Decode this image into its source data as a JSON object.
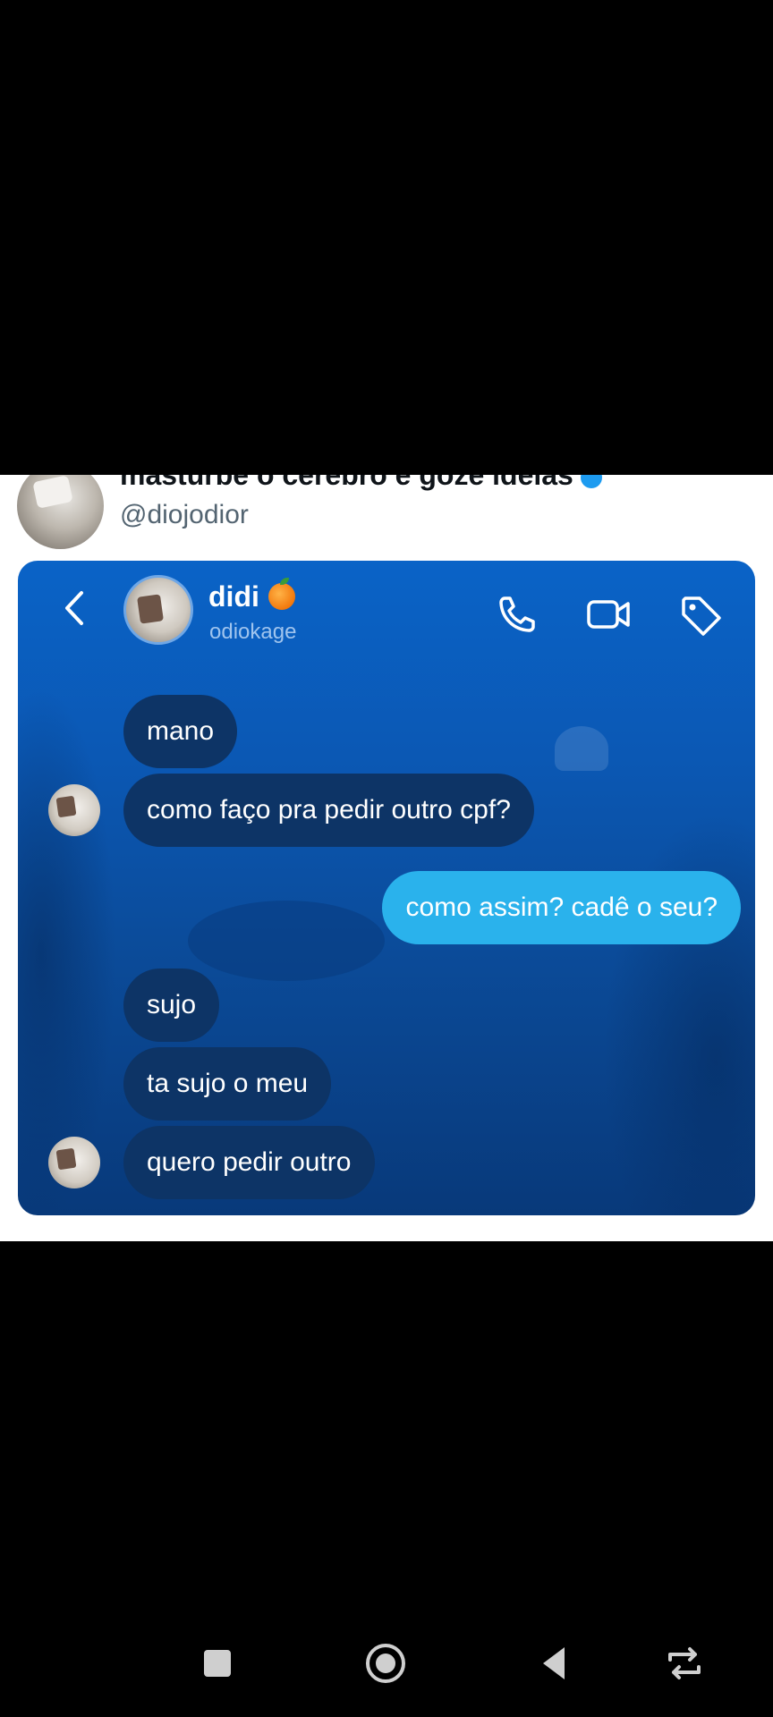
{
  "tweet": {
    "display_name": "masturbe o cérebro e goze ideias",
    "handle": "@diojodior"
  },
  "chat": {
    "contact_name": "didi",
    "contact_username": "odiokage",
    "header_icons": [
      "back-icon",
      "phone-icon",
      "video-icon",
      "tag-icon"
    ],
    "messages": [
      {
        "side": "in",
        "text": "mano"
      },
      {
        "side": "in",
        "text": "como faço pra pedir outro cpf?"
      },
      {
        "side": "out",
        "text": "como assim? cadê o seu?"
      },
      {
        "side": "in",
        "text": "sujo"
      },
      {
        "side": "in",
        "text": "ta sujo o meu"
      },
      {
        "side": "in",
        "text": "quero pedir outro"
      }
    ],
    "colors": {
      "background": "#0b58b4",
      "incoming_bubble": "#0d3466",
      "outgoing_bubble": "#2ab2ec"
    }
  },
  "navbar": {
    "buttons": [
      "recents-square-icon",
      "home-circle-icon",
      "back-triangle-icon",
      "rotate-icon"
    ]
  }
}
